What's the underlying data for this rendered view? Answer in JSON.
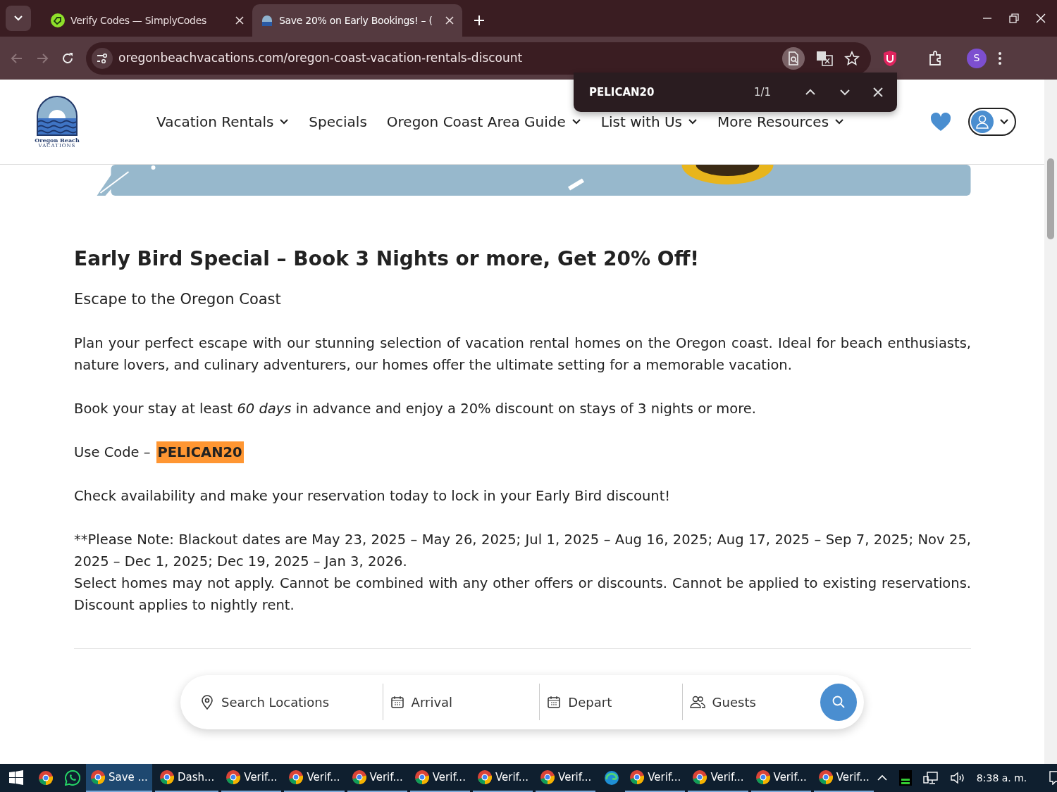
{
  "browser": {
    "tabs": [
      {
        "title": "Verify Codes — SimplyCodes",
        "kind": "simplycodes",
        "selected": false
      },
      {
        "title": "Save 20% on Early Bookings! – (",
        "kind": "site",
        "selected": true
      }
    ],
    "url": "oregonbeachvacations.com/oregon-coast-vacation-rentals-discount",
    "profile_initial": "S"
  },
  "find_bar": {
    "query": "PELICAN20",
    "count": "1/1"
  },
  "site": {
    "logo": {
      "line1": "Oregon Beach",
      "line2": "VACATIONS"
    },
    "nav": [
      {
        "label": "Vacation Rentals",
        "dropdown": true
      },
      {
        "label": "Specials",
        "dropdown": false
      },
      {
        "label": "Oregon Coast Area Guide",
        "dropdown": true
      },
      {
        "label": "List with Us",
        "dropdown": true
      },
      {
        "label": "More Resources",
        "dropdown": true
      }
    ]
  },
  "article": {
    "title": "Early Bird Special – Book 3 Nights or more, Get 20% Off!",
    "subtitle": "Escape to the Oregon Coast",
    "paragraphs": [
      {
        "kind": "text",
        "text": "Plan your perfect escape with our stunning selection of vacation rental homes on the Oregon coast. Ideal for beach enthusiasts, nature lovers, and culinary adventurers, our homes offer the ultimate setting for a memorable vacation."
      },
      {
        "kind": "text",
        "text": "Book your stay at least *60 days* in advance and enjoy a 20% discount on stays of 3 nights or more."
      },
      {
        "kind": "code",
        "label": "Use Code –",
        "code": "PELICAN20",
        "highlighted": true
      },
      {
        "kind": "text",
        "text": "Check availability and make your reservation today to lock in your Early Bird discount!"
      },
      {
        "kind": "note",
        "lines": [
          "**Please Note: Blackout dates are May 23, 2025 – May 26, 2025; Jul 1, 2025 – Aug 16, 2025; Aug 17, 2025 – Sep 7, 2025; Nov 25, 2025 – Dec 1, 2025; Dec 19, 2025 – Jan 3, 2026.",
          "Select homes may not apply. Cannot be combined with any other offers or discounts. Cannot be applied to existing reservations. Discount applies to nightly rent."
        ]
      }
    ]
  },
  "search": {
    "fields": [
      {
        "kind": "location",
        "placeholder": "Search Locations"
      },
      {
        "kind": "date",
        "placeholder": "Arrival"
      },
      {
        "kind": "date",
        "placeholder": "Depart"
      },
      {
        "kind": "guests",
        "placeholder": "Guests"
      }
    ]
  },
  "taskbar": {
    "items": [
      {
        "kind": "chrome"
      },
      {
        "kind": "whatsapp"
      },
      {
        "kind": "window",
        "label": "Save ...",
        "selected": true
      },
      {
        "kind": "window",
        "label": "Dash...",
        "selected": false
      },
      {
        "kind": "window",
        "label": "Verif...",
        "selected": false
      },
      {
        "kind": "window",
        "label": "Verif...",
        "selected": false
      },
      {
        "kind": "window",
        "label": "Verif...",
        "selected": false
      },
      {
        "kind": "window",
        "label": "Verif...",
        "selected": false
      },
      {
        "kind": "window",
        "label": "Verif...",
        "selected": false
      },
      {
        "kind": "window",
        "label": "Verif...",
        "selected": false
      },
      {
        "kind": "edge"
      },
      {
        "kind": "window",
        "label": "Verif...",
        "selected": false
      },
      {
        "kind": "window",
        "label": "Verif...",
        "selected": false
      },
      {
        "kind": "window",
        "label": "Verif...",
        "selected": false
      },
      {
        "kind": "window",
        "label": "Verif...",
        "selected": false
      }
    ],
    "clock": "8:38 a. m."
  }
}
